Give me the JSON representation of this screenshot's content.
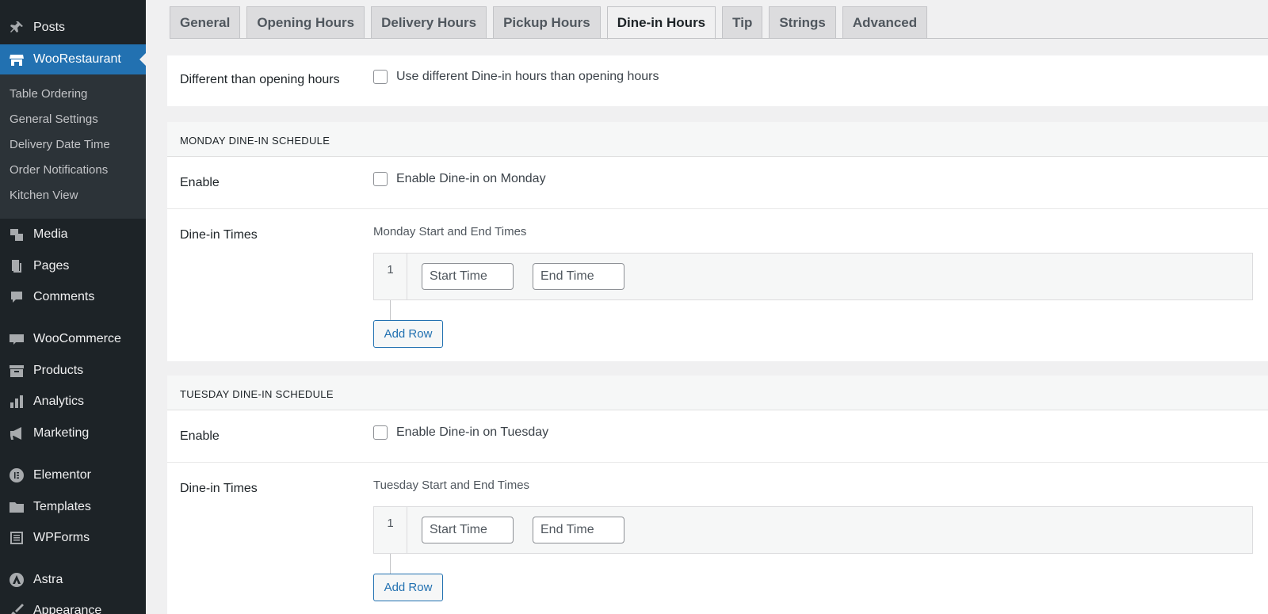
{
  "sidebar": {
    "items": [
      {
        "label": "Posts",
        "icon": "pin-icon"
      },
      {
        "label": "WooRestaurant",
        "icon": "store-icon"
      },
      {
        "label": "Media",
        "icon": "media-icon"
      },
      {
        "label": "Pages",
        "icon": "pages-icon"
      },
      {
        "label": "Comments",
        "icon": "comment-icon"
      },
      {
        "label": "WooCommerce",
        "icon": "woo-icon"
      },
      {
        "label": "Products",
        "icon": "archive-icon"
      },
      {
        "label": "Analytics",
        "icon": "chart-bar-icon"
      },
      {
        "label": "Marketing",
        "icon": "megaphone-icon"
      },
      {
        "label": "Elementor",
        "icon": "elementor-icon"
      },
      {
        "label": "Templates",
        "icon": "folder-icon"
      },
      {
        "label": "WPForms",
        "icon": "forms-icon"
      },
      {
        "label": "Astra",
        "icon": "astra-icon"
      },
      {
        "label": "Appearance",
        "icon": "brush-icon"
      }
    ],
    "submenu": [
      "Table Ordering",
      "General Settings",
      "Delivery Date Time",
      "Order Notifications",
      "Kitchen View"
    ]
  },
  "tabs": [
    "General",
    "Opening Hours",
    "Delivery Hours",
    "Pickup Hours",
    "Dine-in Hours",
    "Tip",
    "Strings",
    "Advanced"
  ],
  "active_tab": "Dine-in Hours",
  "general": {
    "label": "Different than opening hours",
    "checkbox_text": "Use different Dine-in hours than opening hours"
  },
  "monday": {
    "title": "MONDAY DINE-IN SCHEDULE",
    "enable_label": "Enable",
    "enable_text": "Enable Dine-in on Monday",
    "times_label": "Dine-in Times",
    "times_sublabel": "Monday Start and End Times",
    "row_num": "1",
    "start_placeholder": "Start Time",
    "end_placeholder": "End Time",
    "add_row": "Add Row"
  },
  "tuesday": {
    "title": "TUESDAY DINE-IN SCHEDULE",
    "enable_label": "Enable",
    "enable_text": "Enable Dine-in on Tuesday",
    "times_label": "Dine-in Times",
    "times_sublabel": "Tuesday Start and End Times",
    "row_num": "1",
    "start_placeholder": "Start Time",
    "end_placeholder": "End Time",
    "add_row": "Add Row"
  }
}
